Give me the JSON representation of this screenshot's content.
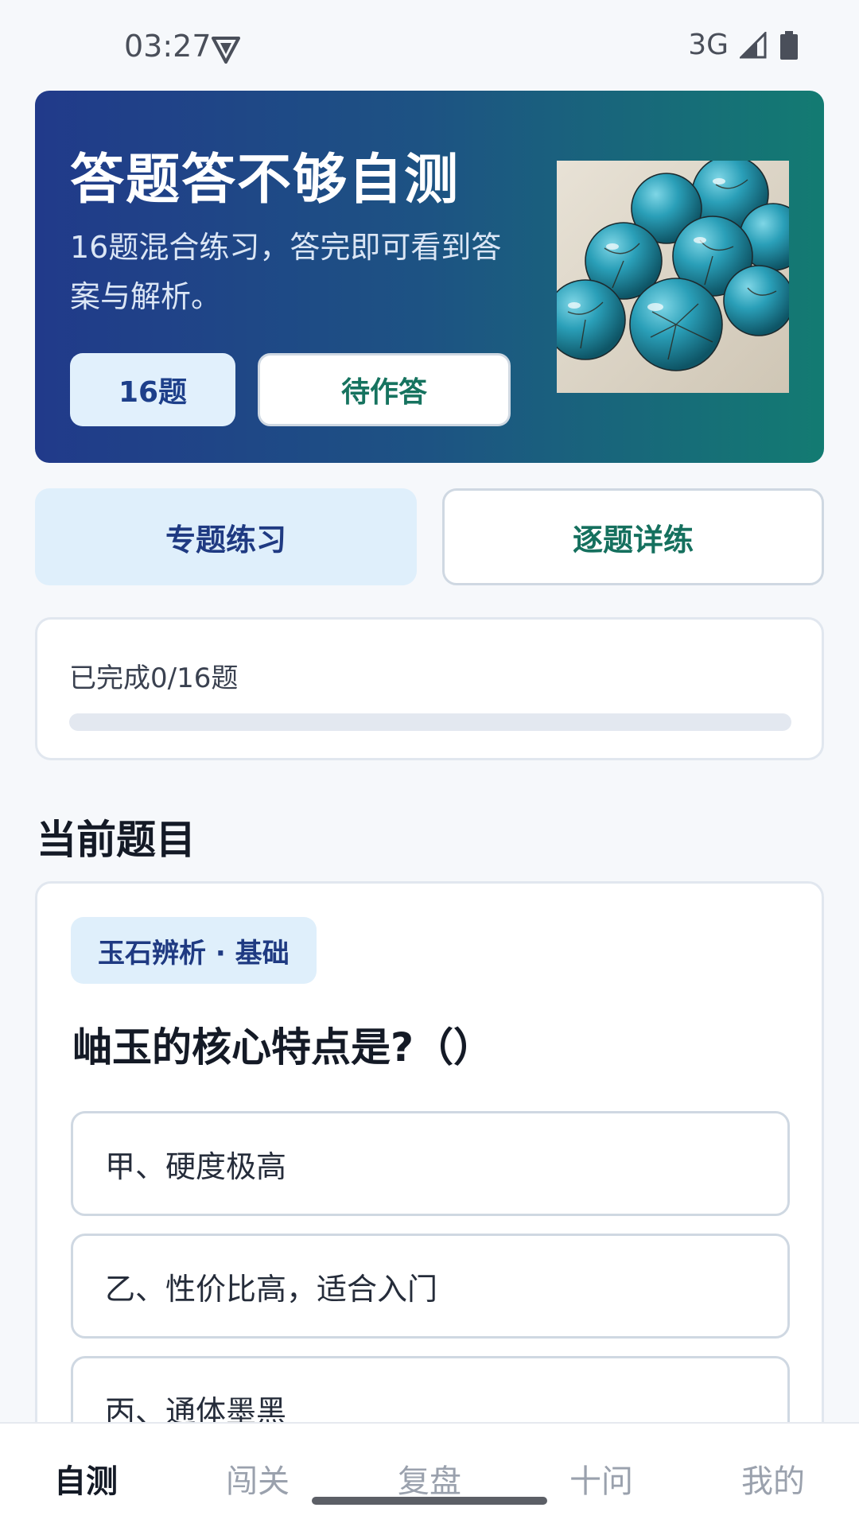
{
  "status_bar": {
    "time": "03:27",
    "network": "3G",
    "icons": [
      "vpn-shield-icon",
      "signal-icon",
      "battery-icon"
    ]
  },
  "hero": {
    "title": "答题答不够自测",
    "subtitle": "16题混合练习，答完即可看到答案与解析。",
    "count_label": "16题",
    "status_label": "待作答",
    "image": "turquoise-beads-photo"
  },
  "modes": {
    "topic_label": "专题练习",
    "each_label": "逐题详练"
  },
  "progress": {
    "text": "已完成0/16题",
    "completed": 0,
    "total": 16
  },
  "section": {
    "current_title": "当前题目"
  },
  "question": {
    "tag": "玉石辨析 · 基础",
    "text": "岫玉的核心特点是?（）",
    "options": [
      "甲、硬度极高",
      "乙、性价比高，适合入门",
      "丙、通体墨黑"
    ]
  },
  "bottom_nav": {
    "items": [
      "自测",
      "闯关",
      "复盘",
      "十问",
      "我的"
    ],
    "active": "自测"
  },
  "colors": {
    "hero_gradient_start": "#213a8a",
    "hero_gradient_end": "#137b72",
    "accent_blue": "#1f3a82",
    "accent_green": "#15705e",
    "page_bg": "#f6f8fb"
  }
}
